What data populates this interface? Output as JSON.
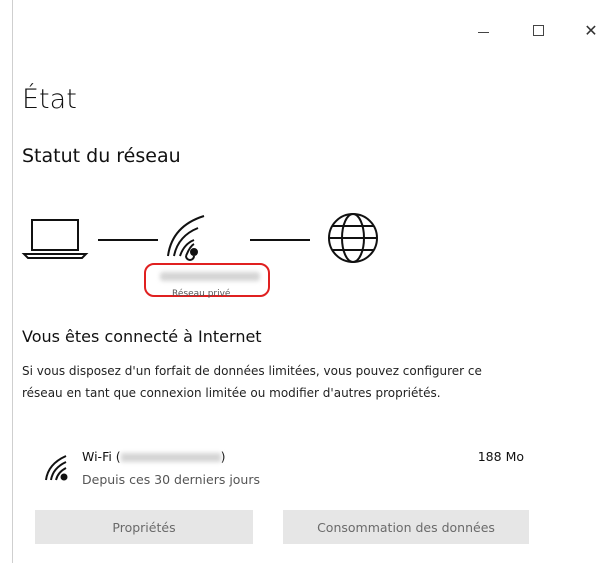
{
  "window": {
    "minimize_icon": "minimize-icon",
    "maximize_icon": "maximize-icon",
    "close_icon": "close-icon",
    "close_glyph": "✕"
  },
  "page": {
    "title": "État"
  },
  "network_status": {
    "title": "Statut du réseau",
    "network_name": "",
    "network_type": "Réseau privé"
  },
  "connection": {
    "status": "Vous êtes connecté à Internet",
    "description": "Si vous disposez d'un forfait de données limitées, vous pouvez configurer ce réseau en tant que connexion limitée ou modifier d'autres propriétés."
  },
  "adapter": {
    "label_prefix": "Wi-Fi (",
    "label_suffix": ")",
    "period": "Depuis ces 30 derniers jours",
    "usage": "188 Mo",
    "icon": "wifi-icon"
  },
  "buttons": {
    "properties": "Propriétés",
    "data_usage": "Consommation des données"
  },
  "colors": {
    "highlight": "#e02020",
    "button_bg": "#e6e6e6"
  }
}
